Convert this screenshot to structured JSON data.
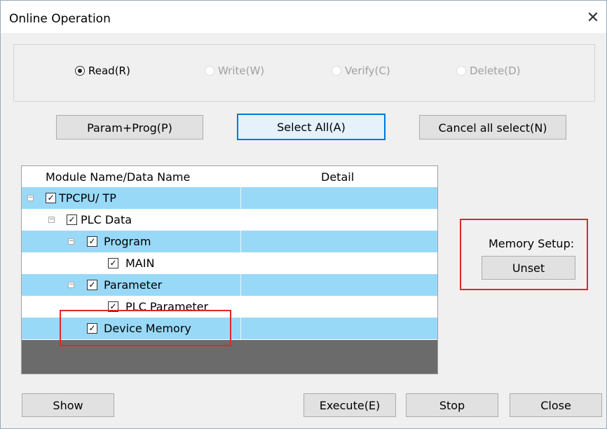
{
  "window": {
    "title": "Online Operation",
    "close_glyph": "✕"
  },
  "operation_mode": {
    "options": [
      {
        "label": "Read(R)",
        "selected": true,
        "enabled": true
      },
      {
        "label": "Write(W)",
        "selected": false,
        "enabled": false
      },
      {
        "label": "Verify(C)",
        "selected": false,
        "enabled": false
      },
      {
        "label": "Delete(D)",
        "selected": false,
        "enabled": false
      }
    ]
  },
  "selection_buttons": {
    "param_prog": "Param+Prog(P)",
    "select_all": "Select All(A)",
    "cancel_all": "Cancel all select(N)"
  },
  "tree": {
    "columns": [
      "Module Name/Data Name",
      "Detail"
    ],
    "rows": [
      {
        "label": "TPCPU/ TP",
        "checked": true,
        "expander": "−"
      },
      {
        "label": "PLC Data",
        "checked": true,
        "expander": "−"
      },
      {
        "label": "Program",
        "checked": true,
        "expander": "−"
      },
      {
        "label": "MAIN",
        "checked": true,
        "expander": ""
      },
      {
        "label": "Parameter",
        "checked": true,
        "expander": "−"
      },
      {
        "label": "PLC Parameter",
        "checked": true,
        "expander": ""
      },
      {
        "label": "Device Memory",
        "checked": true,
        "expander": ""
      }
    ]
  },
  "memory_setup": {
    "label": "Memory Setup:",
    "button": "Unset"
  },
  "footer": {
    "show": "Show",
    "execute": "Execute(E)",
    "stop": "Stop",
    "close": "Close"
  },
  "highlight_color": "#e0262d",
  "row_highlight_color": "#99d9f8",
  "check_glyph": "✓"
}
